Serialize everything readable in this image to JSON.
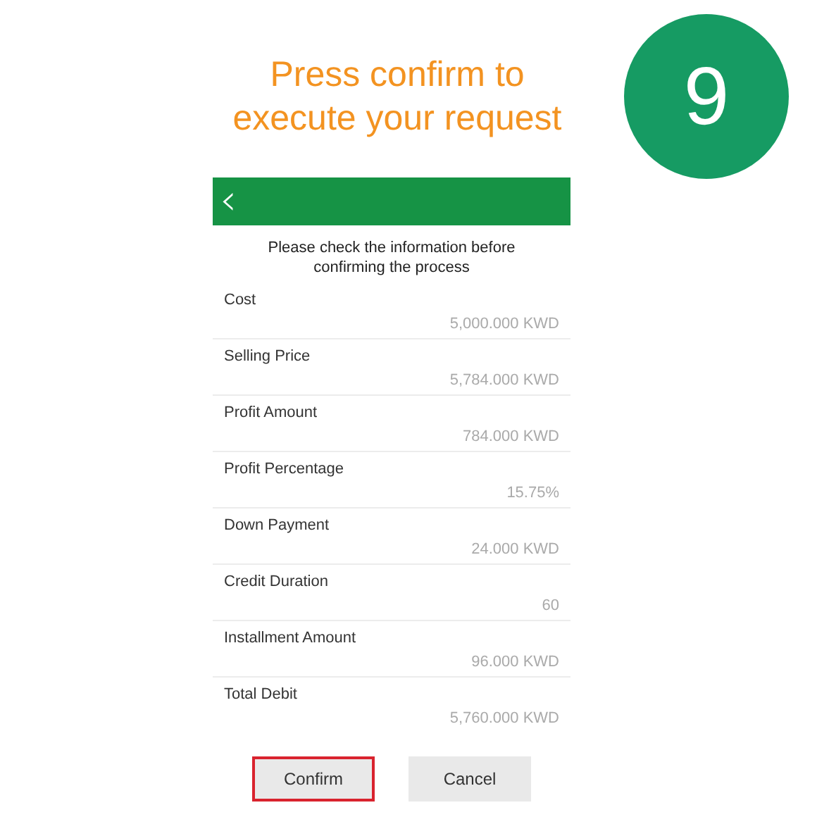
{
  "heading": "Press confirm to execute your request",
  "step_badge": "9",
  "screen": {
    "back_button": "‹",
    "instruction": "Please check the information before confirming the process",
    "fields": [
      {
        "label": "Cost",
        "value": "5,000.000 KWD"
      },
      {
        "label": "Selling Price",
        "value": "5,784.000 KWD"
      },
      {
        "label": "Profit Amount",
        "value": "784.000 KWD"
      },
      {
        "label": "Profit Percentage",
        "value": "15.75%"
      },
      {
        "label": "Down Payment",
        "value": "24.000 KWD"
      },
      {
        "label": "Credit Duration",
        "value": "60"
      },
      {
        "label": "Installment Amount",
        "value": "96.000 KWD"
      },
      {
        "label": "Total Debit",
        "value": "5,760.000 KWD"
      }
    ],
    "buttons": [
      {
        "label": "Confirm",
        "highlighted": true
      },
      {
        "label": "Cancel",
        "highlighted": false
      }
    ]
  }
}
